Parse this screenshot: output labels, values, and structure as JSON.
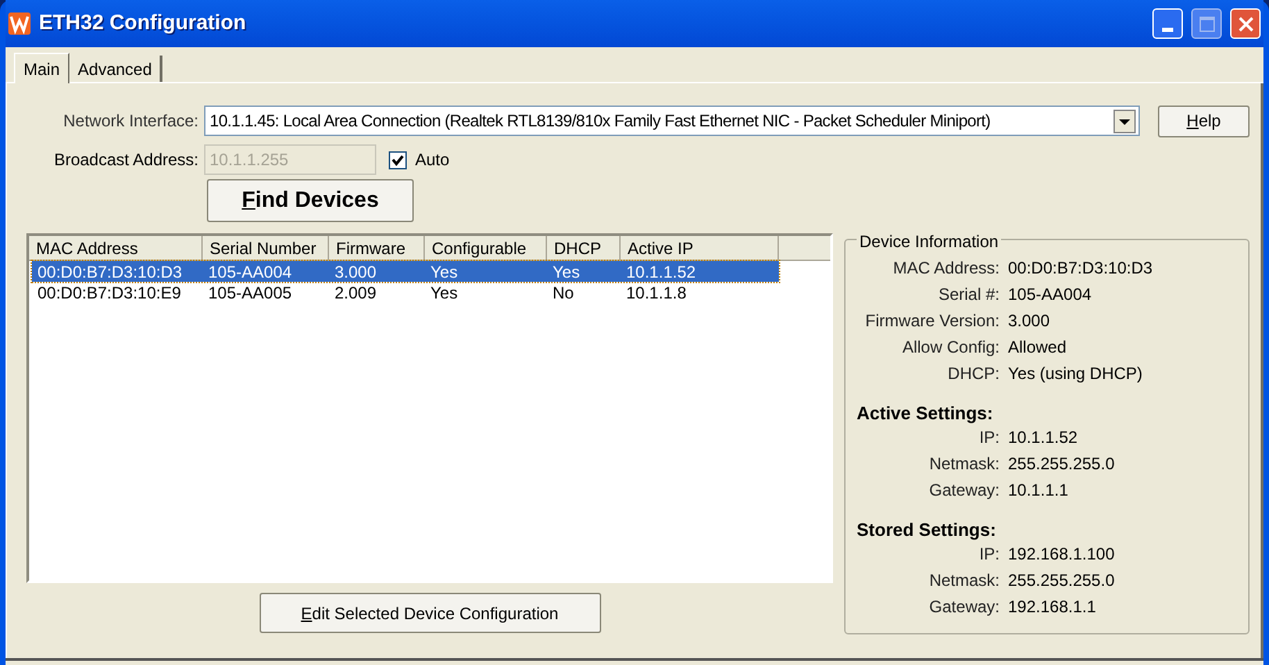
{
  "window": {
    "title": "ETH32 Configuration"
  },
  "tabs": [
    {
      "label": "Main",
      "selected": true
    },
    {
      "label": "Advanced",
      "selected": false
    }
  ],
  "network_interface": {
    "label": "Network Interface:",
    "value": "10.1.1.45: Local Area Connection (Realtek RTL8139/810x Family Fast Ethernet NIC - Packet Scheduler Miniport)"
  },
  "help_button": "Help",
  "broadcast": {
    "label": "Broadcast Address:",
    "value": "10.1.1.255",
    "disabled": true
  },
  "auto": {
    "label": "Auto",
    "checked": true
  },
  "find_button": "Find Devices",
  "table": {
    "columns": [
      "MAC Address",
      "Serial Number",
      "Firmware",
      "Configurable",
      "DHCP",
      "Active IP"
    ],
    "rows": [
      {
        "cells": [
          "00:D0:B7:D3:10:D3",
          "105-AA004",
          "3.000",
          "Yes",
          "Yes",
          "10.1.1.52"
        ],
        "selected": true
      },
      {
        "cells": [
          "00:D0:B7:D3:10:E9",
          "105-AA005",
          "2.009",
          "Yes",
          "No",
          "10.1.1.8"
        ],
        "selected": false
      }
    ]
  },
  "edit_button": "Edit Selected Device Configuration",
  "device_info": {
    "title": "Device Information",
    "sections": [
      {
        "fields": [
          {
            "label": "MAC Address:",
            "value": "00:D0:B7:D3:10:D3"
          },
          {
            "label": "Serial #:",
            "value": "105-AA004"
          },
          {
            "label": "Firmware Version:",
            "value": "3.000"
          },
          {
            "label": "Allow Config:",
            "value": "Allowed"
          },
          {
            "label": "DHCP:",
            "value": "Yes (using DHCP)"
          }
        ]
      },
      {
        "heading": "Active Settings:",
        "fields": [
          {
            "label": "IP:",
            "value": "10.1.1.52"
          },
          {
            "label": "Netmask:",
            "value": "255.255.255.0"
          },
          {
            "label": "Gateway:",
            "value": "10.1.1.1"
          }
        ]
      },
      {
        "heading": "Stored Settings:",
        "fields": [
          {
            "label": "IP:",
            "value": "192.168.1.100"
          },
          {
            "label": "Netmask:",
            "value": "255.255.255.0"
          },
          {
            "label": "Gateway:",
            "value": "192.168.1.1"
          }
        ]
      }
    ]
  }
}
